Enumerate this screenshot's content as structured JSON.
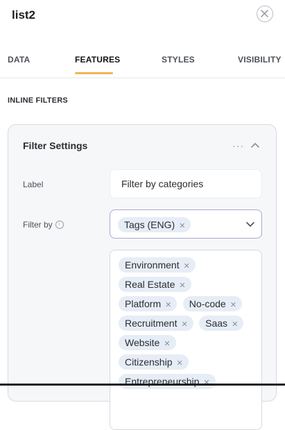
{
  "header": {
    "title": "list2"
  },
  "tabs": [
    {
      "label": "DATA"
    },
    {
      "label": "FEATURES"
    },
    {
      "label": "STYLES"
    },
    {
      "label": "VISIBILITY"
    }
  ],
  "active_tab": "FEATURES",
  "section": {
    "title": "INLINE FILTERS"
  },
  "card": {
    "title": "Filter Settings",
    "more_icon": "more-horizontal-icon",
    "collapse_icon": "chevron-up-icon"
  },
  "fields": {
    "label": {
      "label": "Label",
      "value": "Filter by categories"
    },
    "filter_by": {
      "label": "Filter by",
      "selected": "Tags (ENG)",
      "info_icon": "info-icon"
    }
  },
  "tags": [
    [
      "Environment"
    ],
    [
      "Real Estate"
    ],
    [
      "Platform",
      "No-code"
    ],
    [
      "Recruitment",
      "Saas"
    ],
    [
      "Website"
    ],
    [
      "Citizenship"
    ],
    [
      "Entrepreneurship"
    ]
  ],
  "colors": {
    "accent_underline": "#f0b455",
    "select_border": "#a7a9d6",
    "chip_bg": "#e7edf6"
  }
}
